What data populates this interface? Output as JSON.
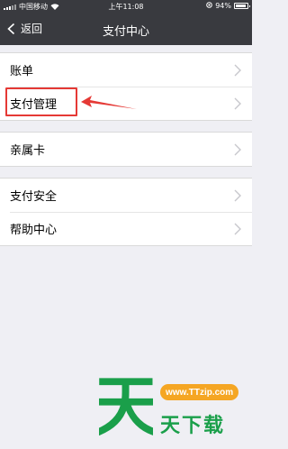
{
  "status_bar": {
    "carrier": "中国移动",
    "time": "上午11:08",
    "battery_percent": "94%",
    "battery_level": 0.94
  },
  "nav": {
    "back_label": "返回",
    "title": "支付中心"
  },
  "groups": [
    {
      "items": [
        {
          "label": "账单"
        },
        {
          "label": "支付管理"
        }
      ]
    },
    {
      "items": [
        {
          "label": "亲属卡"
        }
      ]
    },
    {
      "items": [
        {
          "label": "支付安全"
        },
        {
          "label": "帮助中心"
        }
      ]
    }
  ],
  "annotation": {
    "highlight_color": "#e53935"
  },
  "watermark": {
    "big_char": "天",
    "url": "www.TTzip.com",
    "brand": "天下载",
    "green": "#1a9f4a",
    "orange": "#f5a623"
  }
}
